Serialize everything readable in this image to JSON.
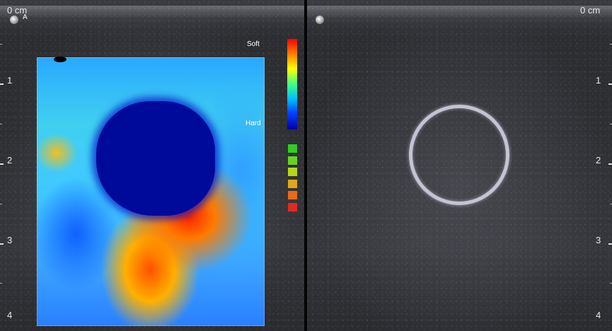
{
  "left_image": {
    "depth_zero_label": "0 cm",
    "marker_label": "A",
    "depth_labels": [
      "1",
      "2",
      "3",
      "4"
    ],
    "elastography": {
      "scale_top_label": "Soft",
      "scale_bottom_label": "Hard",
      "quality_colors": [
        "#33cc22",
        "#66d422",
        "#b5d81c",
        "#e0a818",
        "#e86a1a",
        "#e02a22"
      ]
    }
  },
  "right_image": {
    "depth_zero_label": "0 cm",
    "depth_labels": [
      "1",
      "2",
      "3",
      "4"
    ]
  }
}
